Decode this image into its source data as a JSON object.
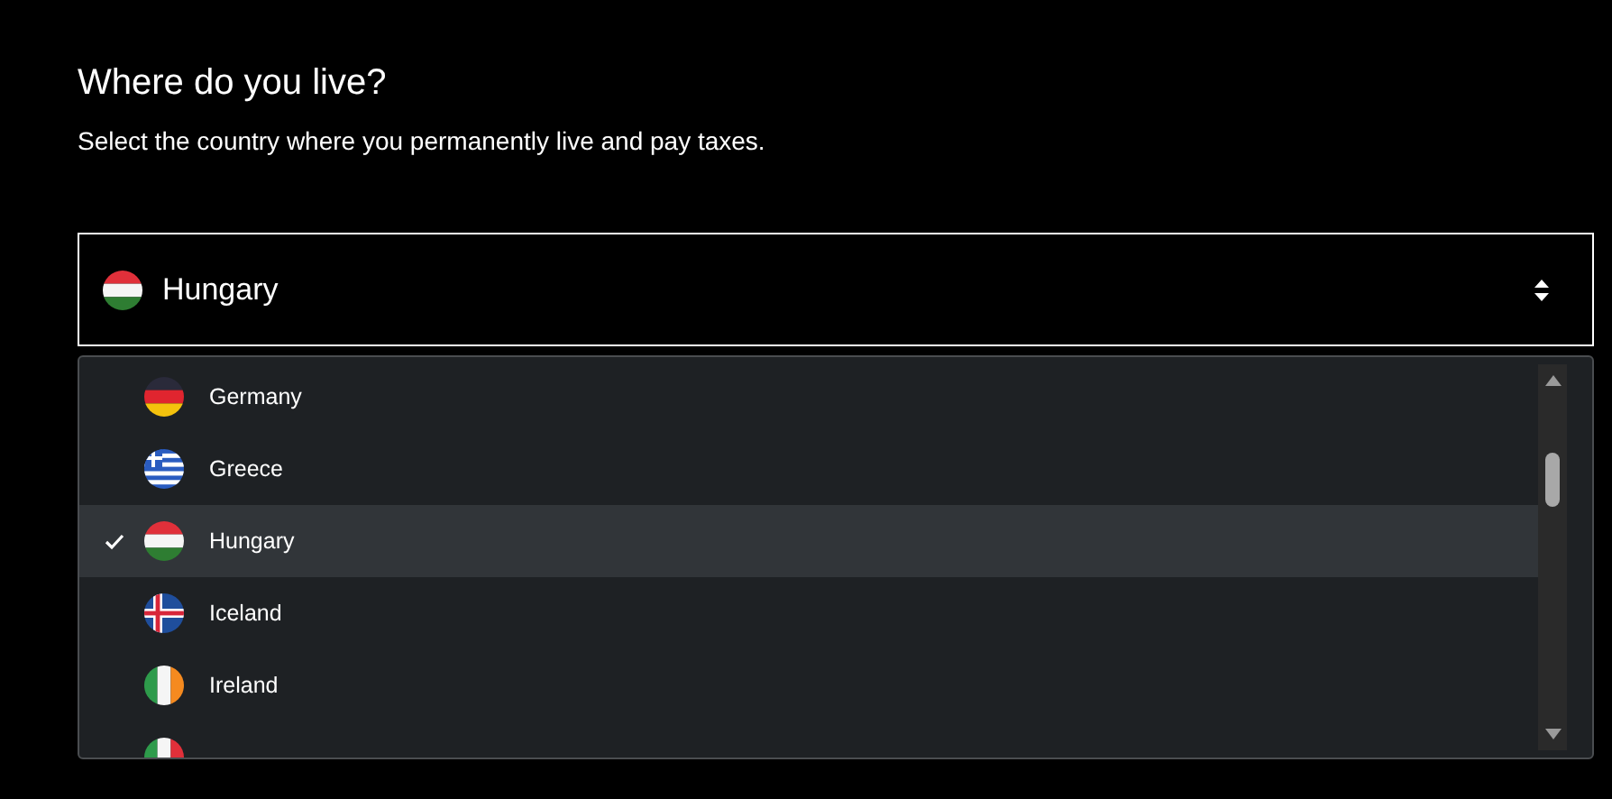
{
  "heading": "Where do you live?",
  "description": "Select the country where you permanently live and pay taxes.",
  "select": {
    "value": "Hungary",
    "kind": "hungary"
  },
  "options": [
    {
      "label": "Germany",
      "kind": "germany",
      "selected": false
    },
    {
      "label": "Greece",
      "kind": "greece",
      "selected": false
    },
    {
      "label": "Hungary",
      "kind": "hungary",
      "selected": true
    },
    {
      "label": "Iceland",
      "kind": "iceland",
      "selected": false
    },
    {
      "label": "Ireland",
      "kind": "ireland",
      "selected": false
    },
    {
      "kind": "italy",
      "selected": false
    }
  ]
}
